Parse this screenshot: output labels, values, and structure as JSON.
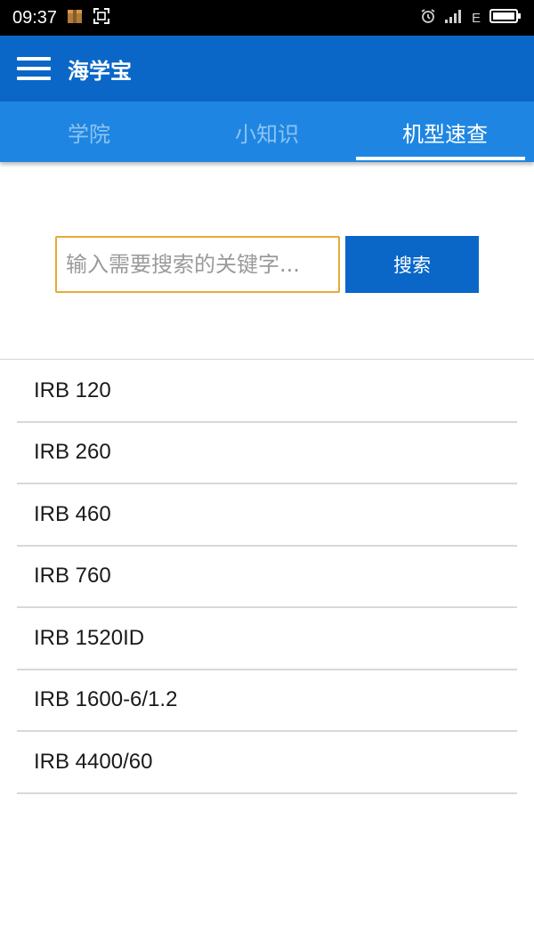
{
  "status_bar": {
    "time": "09:37",
    "network": "E"
  },
  "app_bar": {
    "title": "海学宝"
  },
  "tabs": [
    {
      "label": "学院",
      "active": false
    },
    {
      "label": "小知识",
      "active": false
    },
    {
      "label": "机型速查",
      "active": true
    }
  ],
  "search": {
    "placeholder": "输入需要搜索的关键字...",
    "value": "",
    "button_label": "搜索"
  },
  "models": [
    "IRB 120",
    "IRB 260",
    "IRB 460",
    "IRB 760",
    "IRB 1520ID",
    "IRB 1600-6/1.2",
    "IRB 4400/60"
  ],
  "colors": {
    "app_bar": "#0a67c8",
    "tabs_bar": "#1e86e2",
    "input_focus_border": "#e6a93a"
  }
}
